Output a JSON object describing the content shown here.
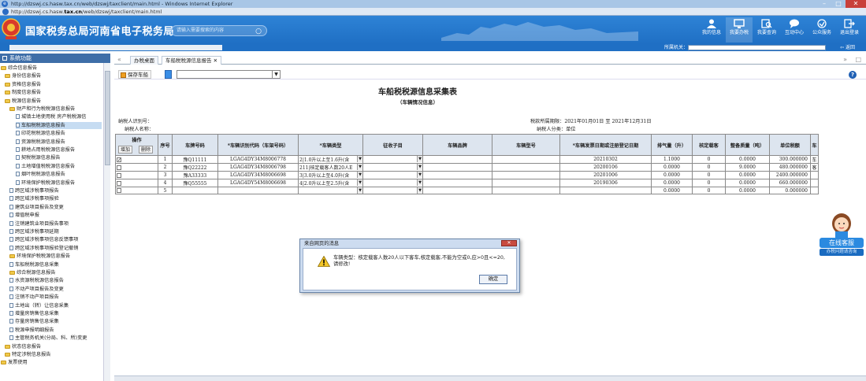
{
  "window": {
    "title": "http://dzswj.cs.hasw.tax.cn/web/dzswj/taxclient/main.html - Windows Internet Explorer",
    "address_prefix": "http://dzswj.cs.hasw.",
    "address_bold": "tax.cn",
    "address_suffix": "/web/dzswj/taxclient/main.html"
  },
  "header": {
    "site_title": "国家税务总局河南省电子税务局",
    "search_placeholder": "请输入需要搜索的内容",
    "nav": [
      {
        "label": "我的信息",
        "icon": "user-icon"
      },
      {
        "label": "我要办税",
        "icon": "monitor-icon"
      },
      {
        "label": "我要查询",
        "icon": "query-icon"
      },
      {
        "label": "互动中心",
        "icon": "chat-icon"
      },
      {
        "label": "公众服务",
        "icon": "service-icon"
      },
      {
        "label": "退出登录",
        "icon": "logout-icon"
      }
    ],
    "agent_label": "所属机关：",
    "return_label": "返回"
  },
  "sidebar": {
    "title": "系统功能",
    "items": [
      {
        "label": "综合信息报告",
        "level": 0,
        "type": "folder"
      },
      {
        "label": "身份信息报告",
        "level": 1,
        "type": "folder"
      },
      {
        "label": "资格信息报告",
        "level": 1,
        "type": "folder"
      },
      {
        "label": "制度信息报告",
        "level": 1,
        "type": "folder"
      },
      {
        "label": "税源信息报告",
        "level": 1,
        "type": "folder"
      },
      {
        "label": "财产和行为税税源信息报告",
        "level": 2,
        "type": "folder"
      },
      {
        "label": "城镇土地使用税 房产税税源信",
        "level": 3,
        "type": "doc"
      },
      {
        "label": "车船税税源信息报告",
        "level": 3,
        "type": "doc",
        "selected": true
      },
      {
        "label": "印花税税源信息报告",
        "level": 3,
        "type": "doc"
      },
      {
        "label": "资源税税源信息报告",
        "level": 3,
        "type": "doc"
      },
      {
        "label": "耕地占用税税源信息报告",
        "level": 3,
        "type": "doc"
      },
      {
        "label": "契税税源信息报告",
        "level": 3,
        "type": "doc"
      },
      {
        "label": "土地增值税税源信息报告",
        "level": 3,
        "type": "doc"
      },
      {
        "label": "烟叶税税源信息报告",
        "level": 3,
        "type": "doc"
      },
      {
        "label": "环境保护税税源信息报告",
        "level": 3,
        "type": "doc"
      },
      {
        "label": "跨区域涉税事项报告",
        "level": 2,
        "type": "doc"
      },
      {
        "label": "跨区域涉税事项报验",
        "level": 2,
        "type": "doc"
      },
      {
        "label": "建筑业项目报告及变更",
        "level": 2,
        "type": "doc"
      },
      {
        "label": "增值税申报",
        "level": 2,
        "type": "doc"
      },
      {
        "label": "注销建筑业项目报告事项",
        "level": 2,
        "type": "doc"
      },
      {
        "label": "跨区域涉税事项延期",
        "level": 2,
        "type": "doc"
      },
      {
        "label": "跨区域涉税事项信息反馈事项",
        "level": 2,
        "type": "doc"
      },
      {
        "label": "跨区域涉税事项报验登记撤销",
        "level": 2,
        "type": "doc"
      },
      {
        "label": "环境保护税税源信息报告",
        "level": 2,
        "type": "folder"
      },
      {
        "label": "车船税税源信息采集",
        "level": 2,
        "type": "doc"
      },
      {
        "label": "综合税源信息报告",
        "level": 2,
        "type": "folder"
      },
      {
        "label": "水资源税税源信息报告",
        "level": 2,
        "type": "doc"
      },
      {
        "label": "不动产项目报告及变更",
        "level": 2,
        "type": "doc"
      },
      {
        "label": "注销不动产项目报告",
        "level": 2,
        "type": "doc"
      },
      {
        "label": "土地出（转）让信息采集",
        "level": 2,
        "type": "doc"
      },
      {
        "label": "增量房销售信息采集",
        "level": 2,
        "type": "doc"
      },
      {
        "label": "存量房销售信息采集",
        "level": 2,
        "type": "doc"
      },
      {
        "label": "税源申报明细报告",
        "level": 2,
        "type": "doc"
      },
      {
        "label": "主管税务机关(分局、科、所)变更",
        "level": 2,
        "type": "doc"
      },
      {
        "label": "状态信息报告",
        "level": 1,
        "type": "folder"
      },
      {
        "label": "特定涉税信息报告",
        "level": 1,
        "type": "folder"
      },
      {
        "label": "发票使用",
        "level": 0,
        "type": "folder"
      }
    ]
  },
  "tabs": [
    {
      "label": "办税桌面",
      "active": false
    },
    {
      "label": "车船税税源信息报告",
      "active": true
    }
  ],
  "toolbar": {
    "save_label": "保存车船"
  },
  "form": {
    "title": "车船税税源信息采集表",
    "subtitle": "（车辆情况信息）",
    "taxpayer_id_label": "纳税人识别号：",
    "taxpayer_name_label": "纳税人名称：",
    "period_label": "税款所属期限：",
    "period_value": "2021年01月01日 至 2021年12月31日",
    "category_label": "纳税人分类：",
    "category_value": "单位"
  },
  "table": {
    "op_title": "操作",
    "add_label": "增加",
    "delete_label": "删除",
    "headers": [
      "序号",
      "车牌号码",
      "*车辆识别代码（车架号码）",
      "*车辆类型",
      "征收子目",
      "车辆品牌",
      "车辆型号",
      "*车辆发票日期或注册登记日期",
      "排气量（升）",
      "核定载客",
      "整备质量（吨）",
      "单位税额",
      "车"
    ],
    "rows": [
      {
        "checked": true,
        "no": "1",
        "plate": "豫Q11111",
        "vin": "LGAG4DY34M8006778",
        "type": "2|1.0升以上至1.6升(含",
        "sub": "",
        "brand": "",
        "model": "",
        "date": "20210302",
        "disp": "1.1000",
        "seats": "0",
        "weight": "0.0000",
        "rate": "300.000000",
        "extra": "车"
      },
      {
        "checked": false,
        "no": "2",
        "plate": "豫Q22222",
        "vin": "LGAG4DY34M8006798",
        "type": "211|核定载客人数20人E",
        "sub": "",
        "brand": "",
        "model": "",
        "date": "20200106",
        "disp": "0.0000",
        "seats": "0",
        "weight": "9.0000",
        "rate": "480.000000",
        "extra": "客"
      },
      {
        "checked": false,
        "no": "3",
        "plate": "豫A33333",
        "vin": "LGAG4DY34M8006698",
        "type": "3|3.0升以上至4.0升(含",
        "sub": "",
        "brand": "",
        "model": "",
        "date": "20201006",
        "disp": "0.0000",
        "seats": "0",
        "weight": "0.0000",
        "rate": "2400.000000",
        "extra": ""
      },
      {
        "checked": false,
        "no": "4",
        "plate": "豫Q55555",
        "vin": "LGAG4DY54M8006698",
        "type": "4|2.0升以上至2.5升(含",
        "sub": "",
        "brand": "",
        "model": "",
        "date": "20190306",
        "disp": "0.0000",
        "seats": "0",
        "weight": "0.0000",
        "rate": "660.000000",
        "extra": ""
      },
      {
        "checked": false,
        "no": "5",
        "plate": "",
        "vin": "",
        "type": "",
        "sub": "",
        "brand": "",
        "model": "",
        "date": "",
        "disp": "0.0000",
        "seats": "0",
        "weight": "0.0000",
        "rate": "0.000000",
        "extra": ""
      }
    ]
  },
  "dialog": {
    "title": "来自网页的消息",
    "message": "车辆类型：核定载客人数20人以下客车,核定载客,不能为空或0,应>0且<=20,请修改!",
    "ok_label": "确定"
  },
  "customer_service": {
    "label": "在线客服",
    "sub_label": "办税问题请咨询"
  },
  "colors": {
    "header_blue": "#1f6fc4",
    "sidebar_head": "#3e6ea8",
    "selected": "#c6dcf2"
  }
}
